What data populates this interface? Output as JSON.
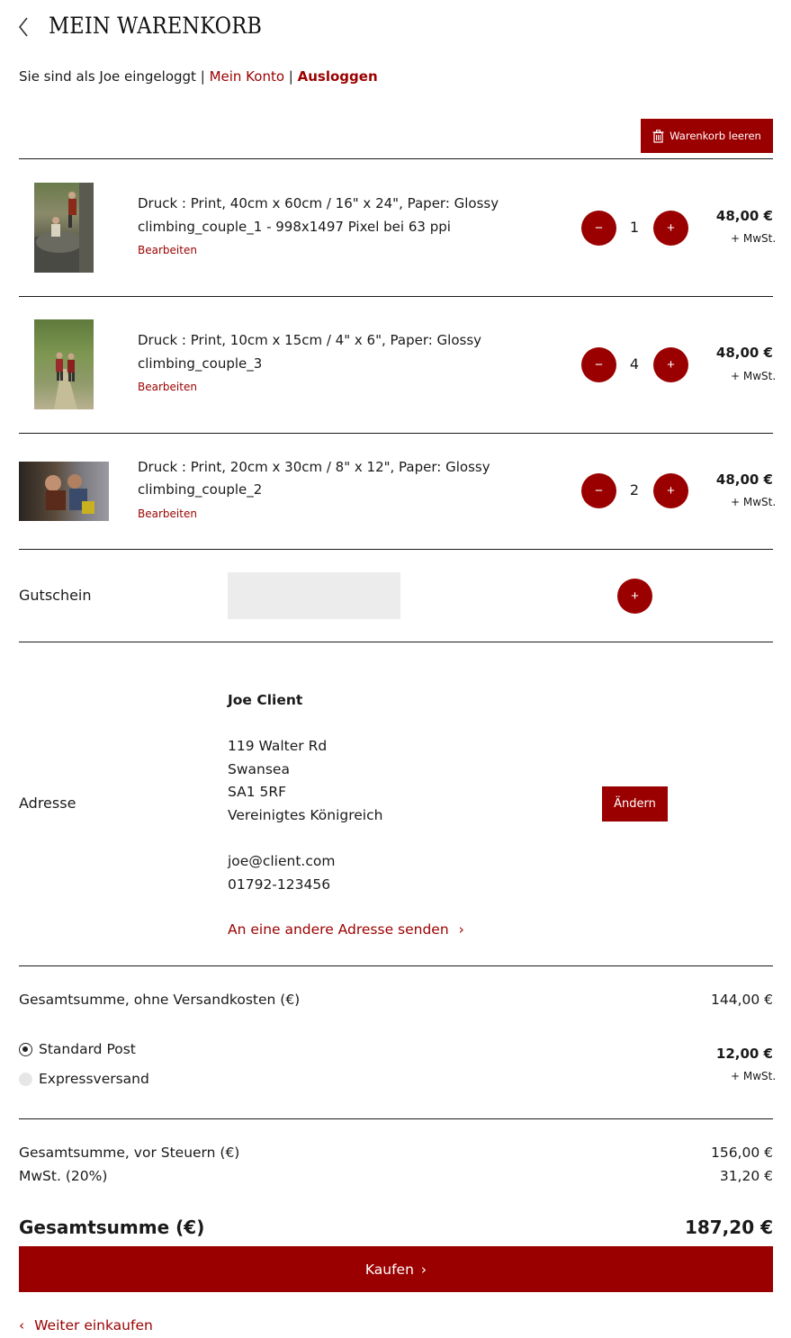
{
  "header": {
    "title": "MEIN WARENKORB",
    "login_prefix": "Sie sind als Joe eingeloggt",
    "separator": "|",
    "account_link": "Mein Konto",
    "logout_link": "Ausloggen"
  },
  "toolbar": {
    "clear_cart_label": "Warenkorb leeren"
  },
  "items": [
    {
      "line1": "Druck : Print, 40cm x 60cm / 16\" x 24\", Paper: Glossy",
      "line2": "climbing_couple_1 - 998x1497 Pixel bei 63 ppi",
      "edit": "Bearbeiten",
      "qty": "1",
      "price": "48,00 €",
      "vat": "+ MwSt."
    },
    {
      "line1": "Druck : Print, 10cm x 15cm / 4\" x 6\", Paper: Glossy",
      "line2": "climbing_couple_3",
      "edit": "Bearbeiten",
      "qty": "4",
      "price": "48,00 €",
      "vat": "+ MwSt."
    },
    {
      "line1": "Druck : Print, 20cm x 30cm / 8\" x 12\", Paper: Glossy",
      "line2": "climbing_couple_2",
      "edit": "Bearbeiten",
      "qty": "2",
      "price": "48,00 €",
      "vat": "+ MwSt."
    }
  ],
  "buttons": {
    "minus": "−",
    "plus": "+"
  },
  "voucher": {
    "label": "Gutschein",
    "placeholder": ""
  },
  "address": {
    "label": "Adresse",
    "name": "Joe Client",
    "street": "119 Walter Rd",
    "city": "Swansea",
    "postcode": "SA1 5RF",
    "country": "Vereinigtes Königreich",
    "email": "joe@client.com",
    "phone": "01792-123456",
    "change_label": "Ändern",
    "alt_address_label": "An eine andere Adresse senden",
    "chevron": "›"
  },
  "totals": {
    "subtotal_label": "Gesamtsumme, ohne Versandkosten (€)",
    "subtotal_value": "144,00 €",
    "shipping_options": [
      {
        "label": "Standard Post",
        "selected": true
      },
      {
        "label": "Expressversand",
        "selected": false
      }
    ],
    "shipping_price": "12,00 €",
    "shipping_vat": "+ MwSt.",
    "pretax_label": "Gesamtsumme, vor Steuern (€)",
    "pretax_value": "156,00 €",
    "vat_label": "MwSt. (20%)",
    "vat_value": "31,20 €",
    "grand_label": "Gesamtsumme (€)",
    "grand_value": "187,20 €"
  },
  "footer": {
    "buy_label": "Kaufen",
    "buy_chevron": "›",
    "continue_chevron": "‹",
    "continue_label": "Weiter einkaufen"
  },
  "colors": {
    "accent": "#9b0000",
    "divider": "#1a1a1a",
    "input_bg": "#ececec"
  }
}
